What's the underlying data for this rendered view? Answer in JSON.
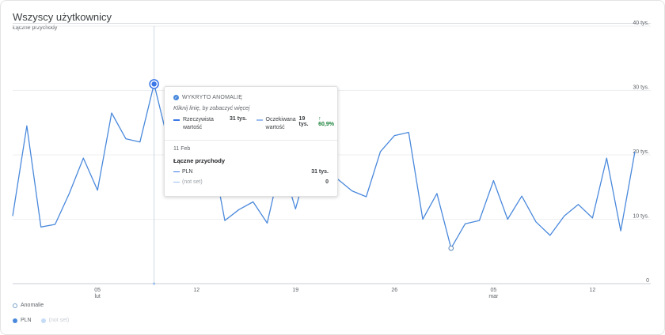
{
  "card": {
    "title": "Wszyscy użytkownicy",
    "metric_label": "Łączne przychody"
  },
  "legend": {
    "anomaly_label": "Anomalie",
    "series": [
      {
        "label": "PLN",
        "color": "#4a89dc",
        "active": true
      },
      {
        "label": "(not set)",
        "color": "#c5dcf7",
        "active": false
      }
    ]
  },
  "tooltip": {
    "header": "WYKRYTO ANOMALIĘ",
    "hint": "Kliknij linię, by zobaczyć więcej",
    "actual_label": "Rzeczywista wartość",
    "actual_value": "31 tys.",
    "expected_label": "Oczekiwana wartość",
    "expected_value": "19 tys.",
    "change": "↑ 60,9%",
    "date": "11 Feb",
    "metric": "Łączne przychody",
    "rows": [
      {
        "name": "PLN",
        "value": "31 tys."
      },
      {
        "name": "(not set)",
        "value": "0"
      }
    ]
  },
  "chart_data": {
    "type": "line",
    "title": "Wszyscy użytkownicy",
    "ylabel": "Łączne przychody",
    "ylim": [
      0,
      40000
    ],
    "y_ticks": [
      {
        "value": 0,
        "label": "0"
      },
      {
        "value": 10000,
        "label": "10 tys."
      },
      {
        "value": 20000,
        "label": "20 tys."
      },
      {
        "value": 30000,
        "label": "30 tys."
      },
      {
        "value": 40000,
        "label": "40 tys."
      }
    ],
    "x_ticks": [
      {
        "index": 6,
        "label": "05",
        "sublabel": "lut"
      },
      {
        "index": 13,
        "label": "12",
        "sublabel": ""
      },
      {
        "index": 20,
        "label": "19",
        "sublabel": ""
      },
      {
        "index": 27,
        "label": "26",
        "sublabel": ""
      },
      {
        "index": 34,
        "label": "05",
        "sublabel": "mar"
      },
      {
        "index": 41,
        "label": "12",
        "sublabel": ""
      }
    ],
    "series": [
      {
        "name": "PLN",
        "color": "#4a89dc",
        "values": [
          10500,
          24500,
          8800,
          9200,
          14000,
          19500,
          14500,
          26500,
          22500,
          22000,
          31000,
          22000,
          17000,
          14000,
          21500,
          9800,
          11500,
          12700,
          9400,
          19000,
          11600,
          19500,
          17800,
          16200,
          14400,
          13500,
          20500,
          23000,
          23500,
          10000,
          14000,
          5500,
          9300,
          9800,
          16000,
          10000,
          13600,
          9600,
          7500,
          10500,
          12300,
          10200,
          19500,
          8200,
          20500
        ]
      }
    ],
    "anomalies": [
      {
        "index": 10,
        "value": 31000,
        "selected": true
      },
      {
        "index": 31,
        "value": 5500,
        "selected": false
      }
    ],
    "highlight_index": 10,
    "grid": true,
    "legend_position": "bottom-left"
  }
}
